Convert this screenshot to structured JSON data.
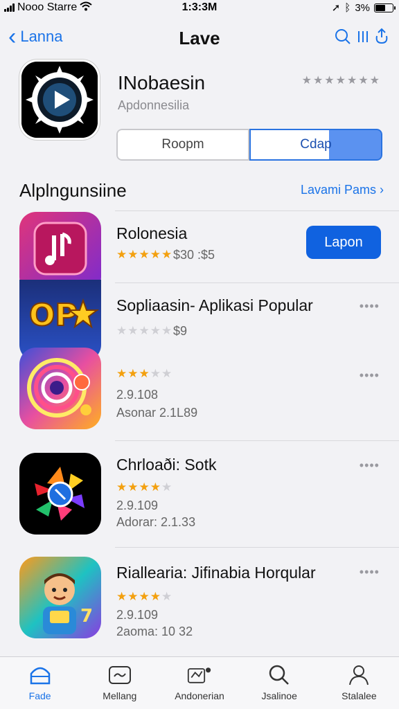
{
  "status": {
    "carrier": "Nooo Starre",
    "time": "1:3:3M",
    "battery": "3%",
    "battery_level": 0.6
  },
  "nav": {
    "back_label": "Lanna",
    "title": "Lave",
    "right_label": "Q"
  },
  "hero": {
    "app_name": "INobaesin",
    "subtitle": "Apdonnesilia",
    "rating_stars": "★★★★★★★",
    "segment_left": "Roopm",
    "segment_right": "Cdap"
  },
  "section": {
    "title": "Alplngunsiine",
    "link": "Lavami Pams ›"
  },
  "list": [
    {
      "title": "Rolonesia",
      "stars_on": 5,
      "stars_off": 0,
      "meta1": "$30 :$5",
      "action": "Lapon"
    },
    {
      "title": "Sopliaasin- Aplikasi Popular",
      "stars_on": 0,
      "stars_off": 5,
      "meta1": "$9",
      "action": "••••"
    },
    {
      "title": "",
      "stars_on": 3,
      "stars_off": 2,
      "meta1": "2.9.108",
      "meta2": "Asonar 2.1L89",
      "action": "••••"
    },
    {
      "title": "Chrloaði: Sotk",
      "stars_on": 4,
      "stars_off": 1,
      "meta1": "2.9.109",
      "meta2": "Adorar: 2.1.33",
      "action": "••••"
    },
    {
      "title": "Riallearia: Jifinabia Horqular",
      "stars_on": 4,
      "stars_off": 1,
      "meta1": "2.9.109",
      "meta2": "2aoma: 10 32",
      "action": "••••"
    }
  ],
  "tabs": [
    {
      "label": "Fade",
      "icon": "today-icon"
    },
    {
      "label": "Mellang",
      "icon": "games-icon"
    },
    {
      "label": "Andonerian",
      "icon": "apps-icon"
    },
    {
      "label": "Jsalinoe",
      "icon": "search-icon"
    },
    {
      "label": "Stalalee",
      "icon": "profile-icon"
    }
  ],
  "colors": {
    "accent": "#1a73e8",
    "button": "#1062e0",
    "star": "#f3a00f"
  }
}
